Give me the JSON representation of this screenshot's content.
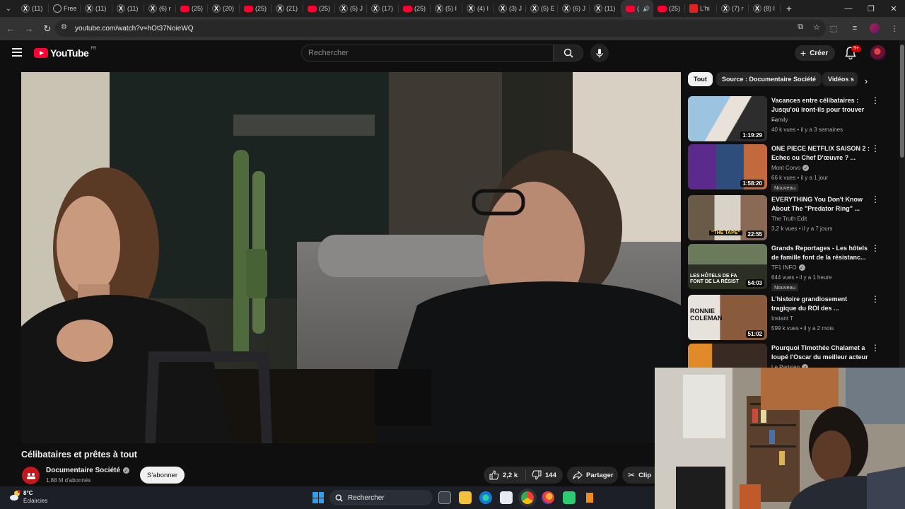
{
  "browser": {
    "tabs": [
      {
        "title": "(11)",
        "icon": "x-icon",
        "kind": "x"
      },
      {
        "title": "Free",
        "icon": "globe-icon",
        "kind": "globe"
      },
      {
        "title": "(11)",
        "icon": "x-icon",
        "kind": "x"
      },
      {
        "title": "(11)",
        "icon": "x-icon",
        "kind": "x"
      },
      {
        "title": "(6) r",
        "icon": "x-icon",
        "kind": "x"
      },
      {
        "title": "(25)",
        "icon": "youtube-icon",
        "kind": "yt"
      },
      {
        "title": "(20)",
        "icon": "x-icon",
        "kind": "x"
      },
      {
        "title": "(25)",
        "icon": "youtube-icon",
        "kind": "yt"
      },
      {
        "title": "(21)",
        "icon": "x-icon",
        "kind": "x"
      },
      {
        "title": "(25)",
        "icon": "youtube-icon",
        "kind": "yt"
      },
      {
        "title": "(5) J",
        "icon": "x-icon",
        "kind": "x"
      },
      {
        "title": "(17)",
        "icon": "x-icon",
        "kind": "x"
      },
      {
        "title": "(25)",
        "icon": "youtube-icon",
        "kind": "yt"
      },
      {
        "title": "(5) I",
        "icon": "x-icon",
        "kind": "x"
      },
      {
        "title": "(4) I",
        "icon": "x-icon",
        "kind": "x"
      },
      {
        "title": "(3) J",
        "icon": "x-icon",
        "kind": "x"
      },
      {
        "title": "(5) E",
        "icon": "x-icon",
        "kind": "x"
      },
      {
        "title": "(6) J",
        "icon": "x-icon",
        "kind": "x"
      },
      {
        "title": "(11)",
        "icon": "x-icon",
        "kind": "x"
      },
      {
        "title": "(",
        "icon": "youtube-icon",
        "kind": "active"
      },
      {
        "title": "(25)",
        "icon": "youtube-icon",
        "kind": "yt"
      },
      {
        "title": "L'hi",
        "icon": "news-icon",
        "kind": "red"
      },
      {
        "title": "(7) r",
        "icon": "x-icon",
        "kind": "x"
      },
      {
        "title": "(8) I",
        "icon": "x-icon",
        "kind": "x"
      }
    ],
    "url": "youtube.com/watch?v=hOt37NoieWQ"
  },
  "header": {
    "logo_text": "YouTube",
    "country": "FR",
    "search_placeholder": "Rechercher",
    "create_label": "Créer",
    "notif_count": "9+"
  },
  "video": {
    "title": "Célibataires et prêtes à tout",
    "channel": "Documentaire Société",
    "subscribers": "1,88 M d'abonnés",
    "subscribe_label": "S'abonner",
    "likes": "2,2 k",
    "dislikes": "144",
    "share_label": "Partager",
    "clip_label": "Clip"
  },
  "chips": [
    "Tout",
    "Source : Documentaire Société",
    "Vidéos s"
  ],
  "recommendations": [
    {
      "title": "Vacances entre célibataires : Jusqu'où iront-ils pour trouver ...",
      "channel": "Family",
      "verified": false,
      "meta": "40 k vues • il y a 3 semaines",
      "duration": "1:19:29",
      "badge": ""
    },
    {
      "title": "ONE PIECE NETFLIX SAISON 2 : Echec ou Chef D'œuvre ? ...",
      "channel": "Mont Corvo",
      "verified": true,
      "meta": "66 k vues • il y a 1 jour",
      "duration": "1:58:20",
      "badge": "Nouveau"
    },
    {
      "title": "EVERYTHING You Don't Know About The \"Predator Ring\" ...",
      "channel": "The Truth Edit",
      "verified": false,
      "meta": "3,2 k vues • il y a 7 jours",
      "duration": "22:55",
      "badge": ""
    },
    {
      "title": "Grands Reportages - Les hôtels de famille font de la résistanc...",
      "channel": "TF1 INFO",
      "verified": true,
      "meta": "644 vues • il y a 1 heure",
      "duration": "54:03",
      "badge": "Nouveau"
    },
    {
      "title": "L'histoire grandiosement tragique du ROI des ...",
      "channel": "Instant T",
      "verified": false,
      "meta": "599 k vues • il y a 2 mois",
      "duration": "51:02",
      "badge": ""
    },
    {
      "title": "Pourquoi Timothée Chalamet a loupé l'Oscar du meilleur acteur",
      "channel": "Le Parisien",
      "verified": true,
      "meta": "",
      "duration": "",
      "badge": ""
    }
  ],
  "thumb_texts": {
    "hotels": "LES HÔTELS DE FA FONT DE LA RÉSIST",
    "ronnie": "RONNIE COLEMAN",
    "tape": "\"THE TAPE\""
  },
  "taskbar": {
    "temperature": "8°C",
    "weather": "Éclaircies",
    "search_label": "Rechercher"
  },
  "colors": {
    "youtube_red": "#ff0033",
    "background": "#0f0f0f",
    "chip_bg": "#272727"
  }
}
